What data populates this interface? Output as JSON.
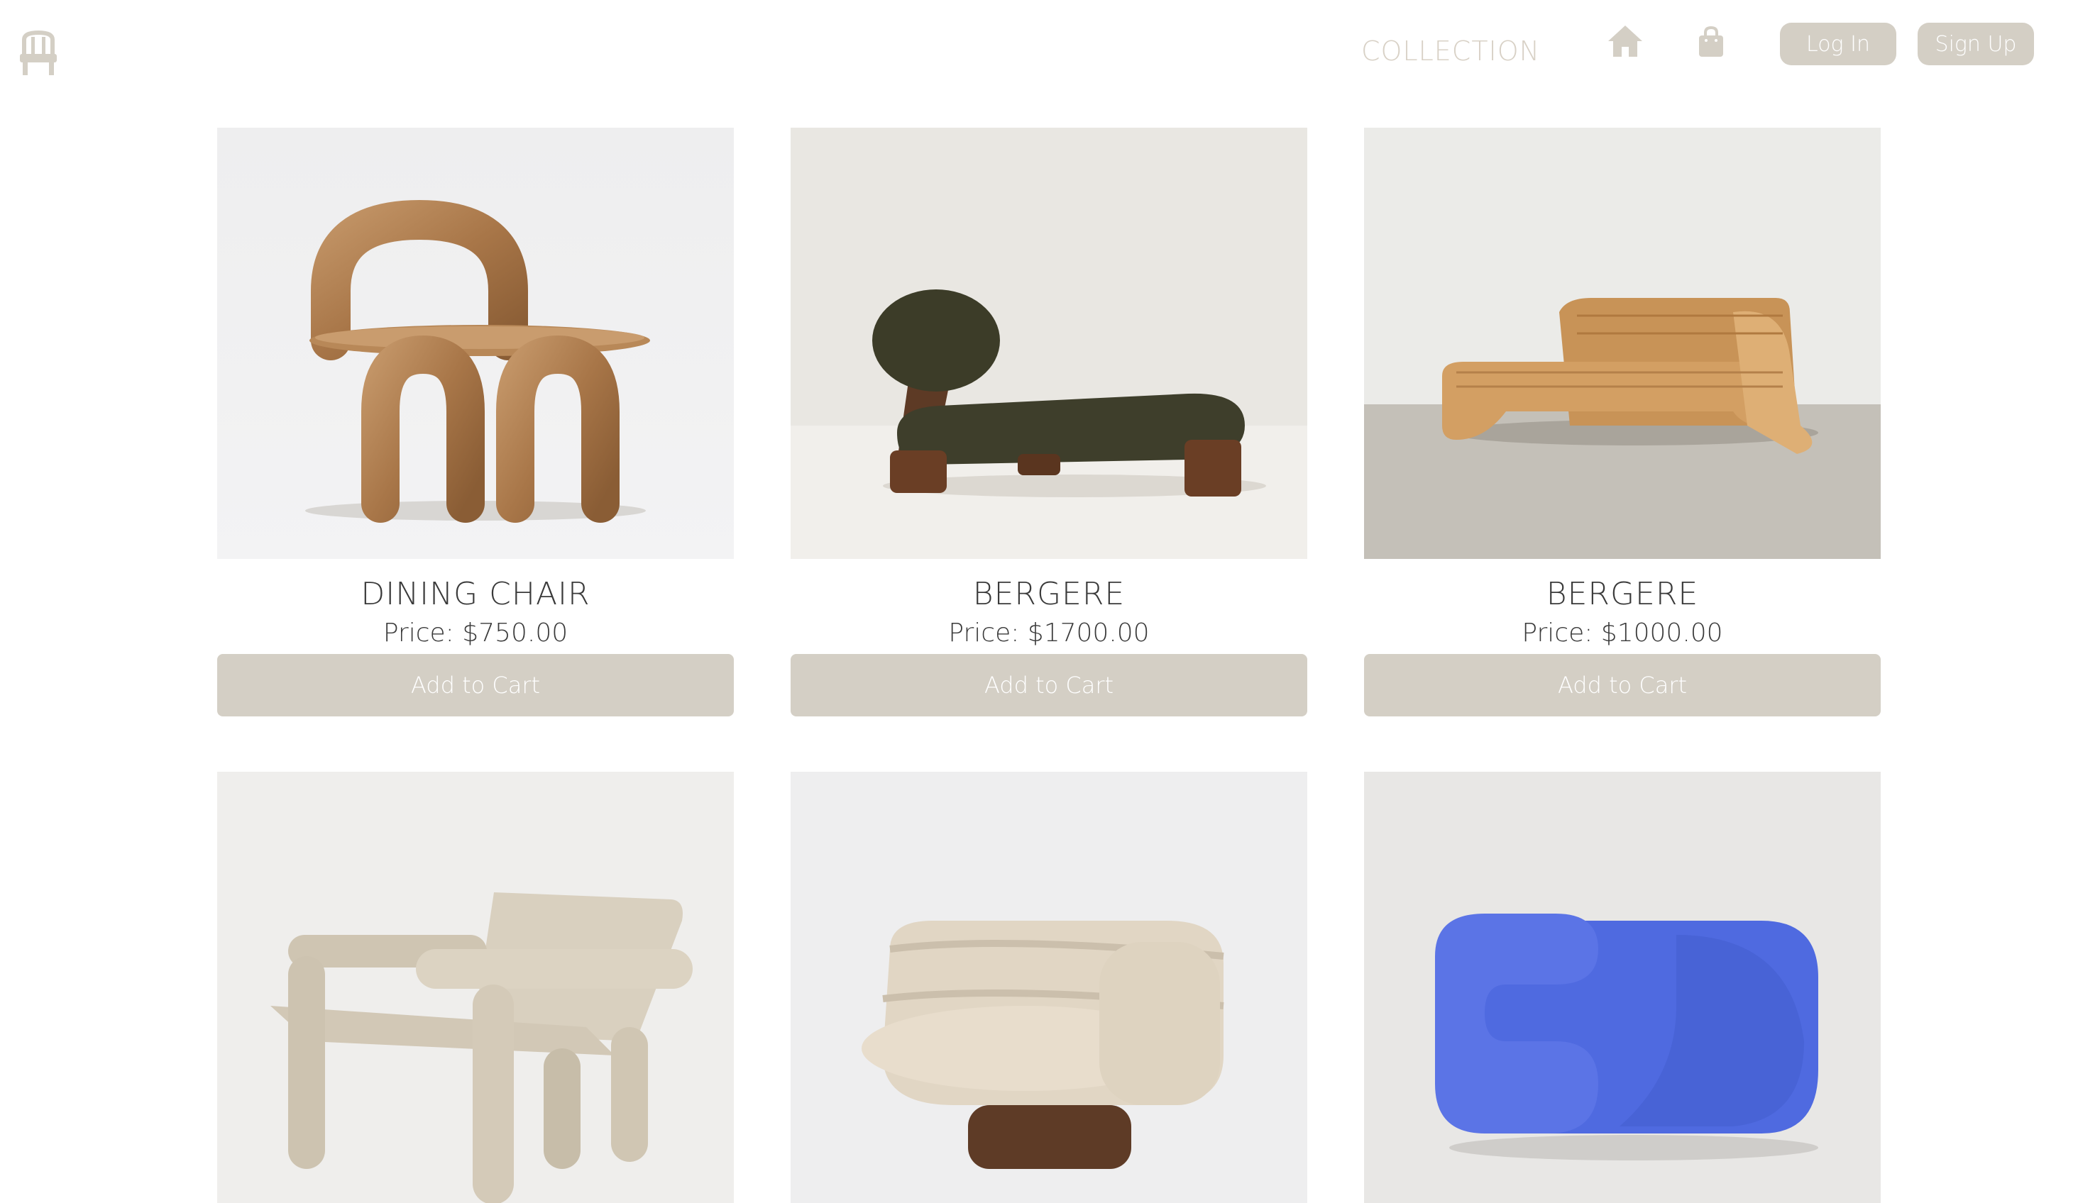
{
  "header": {
    "logo_icon": "chair-icon",
    "nav_collection": "COLLECTION",
    "home_icon": "home-icon",
    "bag_icon": "shopping-bag-icon",
    "login_label": "Log In",
    "signup_label": "Sign Up"
  },
  "colors": {
    "accent": "#d4cfc5",
    "nav_text": "#d8d1c6",
    "text": "#3a3a3a"
  },
  "products": [
    {
      "name": "DINING CHAIR",
      "price": "Price: $750.00",
      "cart_label": "Add to Cart",
      "image": "wooden-arched-chair"
    },
    {
      "name": "BERGERE",
      "price": "Price: $1700.00",
      "cart_label": "Add to Cart",
      "image": "green-chaise-lounge"
    },
    {
      "name": "BERGERE",
      "price": "Price: $1000.00",
      "cart_label": "Add to Cart",
      "image": "rattan-lounge-chair"
    },
    {
      "image": "travertine-armchair"
    },
    {
      "image": "shearling-swivel-chair"
    },
    {
      "image": "blue-velvet-armchair"
    }
  ]
}
